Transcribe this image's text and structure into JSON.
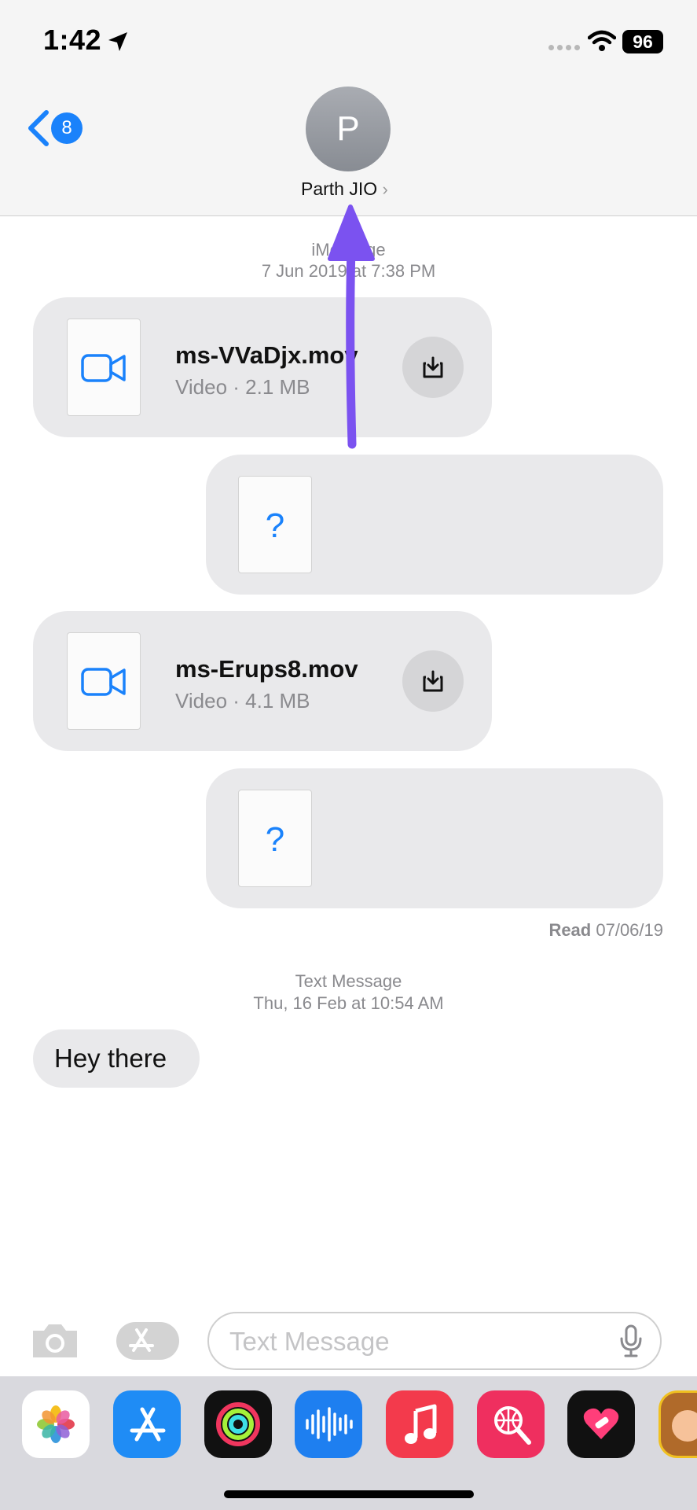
{
  "status_bar": {
    "time": "1:42",
    "battery": "96"
  },
  "header": {
    "back_badge": "8",
    "avatar_initial": "P",
    "contact_name": "Parth JIO",
    "chevron": "›"
  },
  "thread_1": {
    "service": "iMessage",
    "timestamp": "7 Jun 2019 at 7:38 PM"
  },
  "messages": [
    {
      "file_name": "ms-VVaDjx.mov",
      "file_meta": "Video · 2.1 MB"
    },
    {
      "unknown_glyph": "?"
    },
    {
      "file_name": "ms-Erups8.mov",
      "file_meta": "Video · 4.1 MB"
    },
    {
      "unknown_glyph": "?"
    }
  ],
  "read_receipt": {
    "label": "Read",
    "date": "07/06/19"
  },
  "thread_2": {
    "service": "Text Message",
    "timestamp": "Thu, 16 Feb at 10:54 AM",
    "message": "Hey there"
  },
  "composer": {
    "placeholder": "Text Message"
  },
  "dock_apps": [
    "photos-app-icon",
    "app-store-app-icon",
    "activity-app-icon",
    "voice-memos-app-icon",
    "music-app-icon",
    "search-app-icon",
    "heart-app-icon",
    "memoji-app-icon"
  ],
  "colors": {
    "accent": "#1a82fb",
    "annotation_arrow": "#7b52f0",
    "bubble": "#e9e9eb"
  }
}
